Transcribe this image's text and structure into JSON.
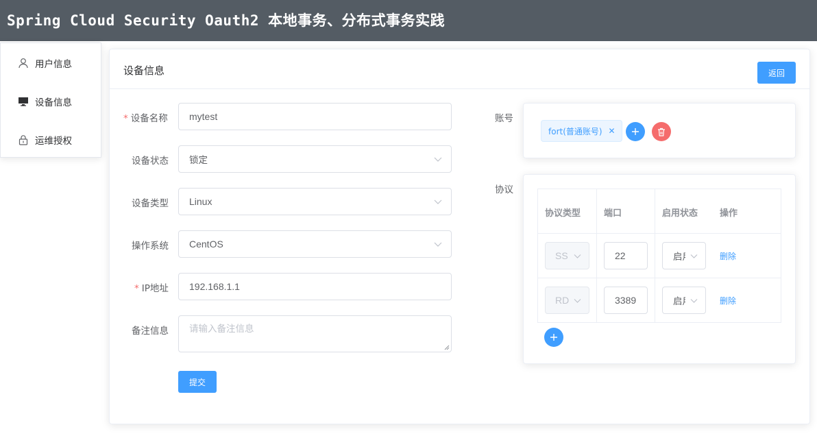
{
  "app": {
    "title": "Spring Cloud Security Oauth2 本地事务、分布式事务实践"
  },
  "sidebar": {
    "items": [
      {
        "label": "用户信息",
        "icon": "user-icon"
      },
      {
        "label": "设备信息",
        "icon": "monitor-icon"
      },
      {
        "label": "运维授权",
        "icon": "lock-icon"
      }
    ]
  },
  "card": {
    "title": "设备信息",
    "back_label": "返回"
  },
  "form": {
    "name_label": "设备名称",
    "name_value": "mytest",
    "status_label": "设备状态",
    "status_value": "锁定",
    "type_label": "设备类型",
    "type_value": "Linux",
    "os_label": "操作系统",
    "os_value": "CentOS",
    "ip_label": "IP地址",
    "ip_value": "192.168.1.1",
    "remark_label": "备注信息",
    "remark_placeholder": "请输入备注信息",
    "submit_label": "提交",
    "required_mark": "*"
  },
  "account": {
    "label": "账号",
    "tags": [
      "fort(普通账号)"
    ]
  },
  "protocol": {
    "label": "协议",
    "headers": [
      "协议类型",
      "端口",
      "启用状态",
      "操作"
    ],
    "rows": [
      {
        "type": "SS",
        "port": "22",
        "status": "启用",
        "action": "删除"
      },
      {
        "type": "RD",
        "port": "3389",
        "status": "启用",
        "action": "删除"
      }
    ]
  },
  "colors": {
    "header_bg": "#545c64",
    "primary": "#409eff",
    "danger": "#f56c6c"
  }
}
